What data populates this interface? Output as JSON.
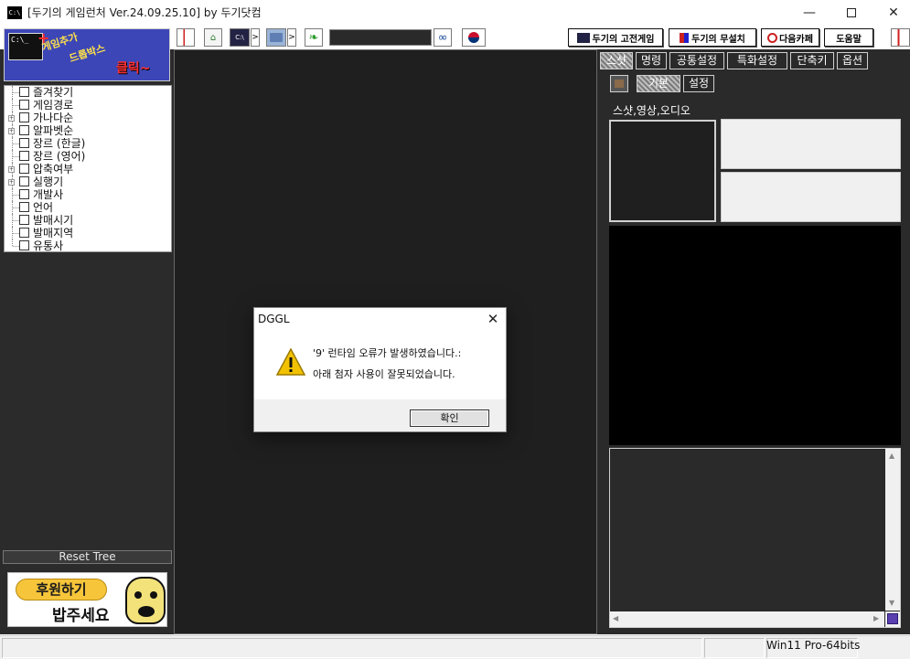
{
  "window": {
    "title": "[두기의 게임런처 Ver.24.09.25.10] by 두기닷컴",
    "app_icon_text": "C:\\",
    "minimize_icon": "minimize-icon",
    "maximize_icon": "maximize-icon",
    "close_icon": "close-icon"
  },
  "toolbar": {
    "buttons": [
      {
        "name": "small-flag-icon"
      },
      {
        "name": "home-icon"
      },
      {
        "name": "console-icon"
      },
      {
        "name": "folder-icon"
      },
      {
        "name": "leaf-icon"
      },
      {
        "name": "binoculars-icon"
      },
      {
        "name": "korea-flag-icon"
      }
    ],
    "search_value": "",
    "right_buttons": [
      {
        "label": "두기의 고전게임"
      },
      {
        "label": "두기의 무설치"
      },
      {
        "label": "다음카페"
      },
      {
        "label": "도움말"
      }
    ],
    "arrow": ">"
  },
  "left_panel": {
    "banner": {
      "top": "게임추가",
      "middle": "드롭박스",
      "bottom": "클릭~",
      "console_text": "C:\\_"
    },
    "tree": [
      {
        "label": "즐겨찾기",
        "expandable": false
      },
      {
        "label": "게임경로",
        "expandable": false
      },
      {
        "label": "가나다순",
        "expandable": true
      },
      {
        "label": "알파벳순",
        "expandable": true
      },
      {
        "label": "장르 (한글)",
        "expandable": false
      },
      {
        "label": "장르 (영어)",
        "expandable": false
      },
      {
        "label": "압축여부",
        "expandable": true
      },
      {
        "label": "실행기",
        "expandable": true
      },
      {
        "label": "개발사",
        "expandable": false
      },
      {
        "label": "언어",
        "expandable": false
      },
      {
        "label": "발매시기",
        "expandable": false
      },
      {
        "label": "발매지역",
        "expandable": false
      },
      {
        "label": "유통사",
        "expandable": false
      }
    ],
    "reset_label": "Reset Tree",
    "donate": {
      "label": "후원하기",
      "sub": "밥주세요"
    }
  },
  "right_panel": {
    "tabs": [
      {
        "label": "스샷",
        "active": true
      },
      {
        "label": "명령",
        "active": false
      },
      {
        "label": "공통설정",
        "active": false
      },
      {
        "label": "특화설정",
        "active": false
      },
      {
        "label": "단축키",
        "active": false
      },
      {
        "label": "옵션",
        "active": false
      }
    ],
    "sub_tabs": [
      {
        "label": "기본",
        "active": true
      },
      {
        "label": "설정",
        "active": false
      }
    ],
    "section_label": "스샷,영상,오디오"
  },
  "status_bar": {
    "os": "Win11 Pro-64bits"
  },
  "dialog": {
    "title": "DGGL",
    "line1": "'9' 런타임 오류가 발생하였습니다.:",
    "line2": "아래 첨자 사용이 잘못되었습니다.",
    "ok_label": "확인"
  },
  "colors": {
    "panel_dark": "#2b2b2b",
    "center_dark": "#1f1f1f",
    "banner_blue": "#3c46b6",
    "donate_yellow": "#f6c53a"
  }
}
